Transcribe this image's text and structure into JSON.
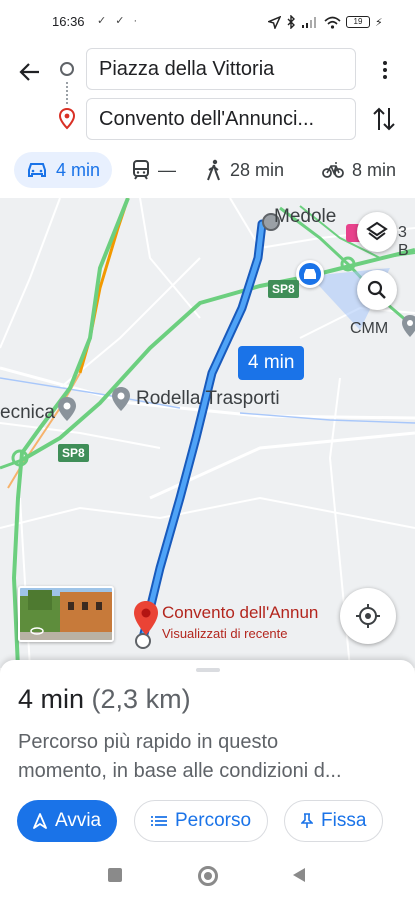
{
  "status_bar": {
    "time": "16:36",
    "notifications": "✓ ✓ ·",
    "battery": "19"
  },
  "directions": {
    "origin": "Piazza della Vittoria",
    "destination": "Convento dell'Annunci...",
    "modes": [
      {
        "icon": "car-icon",
        "label": "4 min",
        "active": true
      },
      {
        "icon": "transit-icon",
        "label": "—",
        "active": false
      },
      {
        "icon": "walk-icon",
        "label": "28 min",
        "active": false
      },
      {
        "icon": "bike-icon",
        "label": "8 min",
        "active": false
      }
    ]
  },
  "map": {
    "town": "Medole",
    "place_cmm": "CMM",
    "place_3b": "3 B",
    "road": "SP8",
    "road2": "SP8",
    "poi_rodella": "Rodella Trasporti",
    "poi_tecnica": "ecnica",
    "route_time": "4 min",
    "destination_title": "Convento dell'Annun",
    "destination_subtitle": "Visualizzati di recente"
  },
  "sheet": {
    "duration": "4 min",
    "distance": "(2,3 km)",
    "description_line1": "Percorso più rapido in questo",
    "description_line2": "momento, in base alle condizioni d...",
    "buttons": {
      "start": "Avvia",
      "route": "Percorso",
      "pin": "Fissa"
    }
  },
  "colors": {
    "accent": "#1a73e8",
    "route": "#1a73e8",
    "destination": "#b3261e",
    "road_green": "#6ccf7f"
  }
}
